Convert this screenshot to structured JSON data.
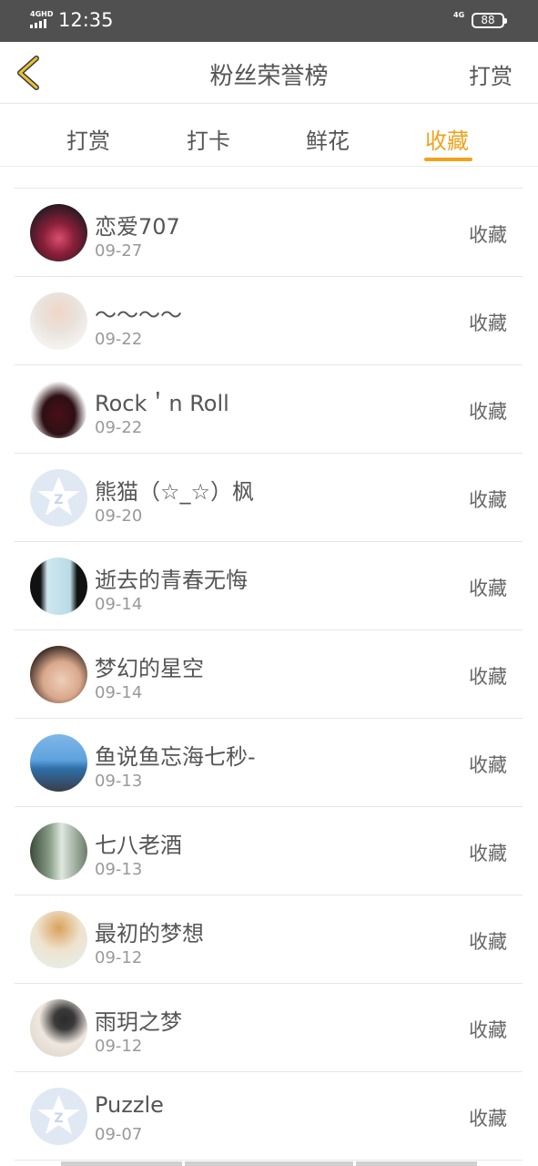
{
  "status_bar": {
    "network_left": "4GHD",
    "time": "12:35",
    "network_right": "4G",
    "battery": "88"
  },
  "header": {
    "title": "粉丝荣誉榜",
    "right_action": "打赏",
    "back_icon": "chevron-left-icon"
  },
  "tabs": [
    {
      "label": "打赏",
      "active": false
    },
    {
      "label": "打卡",
      "active": false
    },
    {
      "label": "鲜花",
      "active": false
    },
    {
      "label": "收藏",
      "active": true
    }
  ],
  "accent_color": "#f1a21d",
  "list": {
    "partial_top_date": "09-27",
    "items": [
      {
        "name": "恋爱707",
        "date": "09-27",
        "action": "收藏"
      },
      {
        "name": "～～～～",
        "date": "09-22",
        "action": "收藏"
      },
      {
        "name": "Rock＇n Roll",
        "date": "09-22",
        "action": "收藏"
      },
      {
        "name": "熊猫（☆_☆）枫",
        "date": "09-20",
        "action": "收藏"
      },
      {
        "name": "逝去的青春无悔",
        "date": "09-14",
        "action": "收藏"
      },
      {
        "name": "梦幻的星空",
        "date": "09-14",
        "action": "收藏"
      },
      {
        "name": "鱼说鱼忘海七秒-",
        "date": "09-13",
        "action": "收藏"
      },
      {
        "name": "七八老酒",
        "date": "09-13",
        "action": "收藏"
      },
      {
        "name": "最初的梦想",
        "date": "09-12",
        "action": "收藏"
      },
      {
        "name": "雨玥之梦",
        "date": "09-12",
        "action": "收藏"
      },
      {
        "name": "Puzzle",
        "date": "09-07",
        "action": "收藏"
      }
    ]
  }
}
